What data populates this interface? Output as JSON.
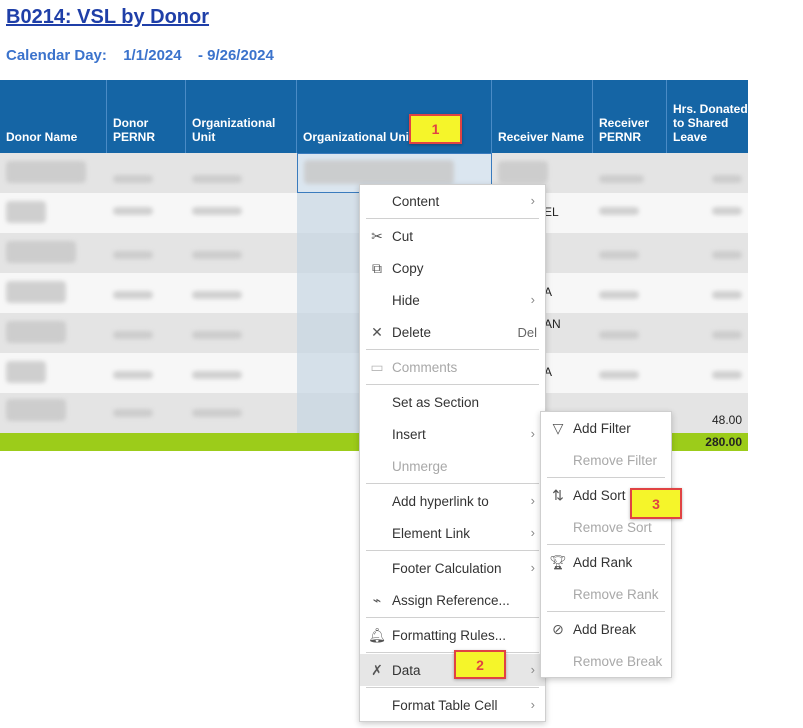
{
  "report": {
    "title": "B0214: VSL by Donor",
    "calendar_label": "Calendar Day:",
    "date_start": "1/1/2024",
    "date_end": "- 9/26/2024"
  },
  "table": {
    "headers": [
      "Donor Name",
      "Donor PERNR",
      "Organizational Unit",
      "Organizational Unit Desc",
      "Receiver Name",
      "Receiver PERNR",
      "Hrs. Donated to Shared Leave"
    ],
    "row7_value": "48.00",
    "footer_total": "280.00",
    "receiver_name_fragments": [
      "EL",
      "A",
      "AN",
      "A"
    ]
  },
  "annotations": {
    "step1": "1",
    "step2": "2",
    "step3": "3"
  },
  "context_menu": {
    "items": [
      {
        "label": "Content",
        "icon": "",
        "submenu": true
      },
      {
        "label": "Cut",
        "icon": "scissors-icon"
      },
      {
        "label": "Copy",
        "icon": "copy-icon"
      },
      {
        "label": "Hide",
        "submenu": true
      },
      {
        "label": "Delete",
        "icon": "close-icon",
        "shortcut": "Del"
      },
      {
        "label": "Comments",
        "icon": "comment-icon",
        "disabled": true
      },
      {
        "label": "Set as Section"
      },
      {
        "label": "Insert",
        "submenu": true
      },
      {
        "label": "Unmerge",
        "disabled": true
      },
      {
        "label": "Add hyperlink to",
        "submenu": true
      },
      {
        "label": "Element Link",
        "submenu": true
      },
      {
        "label": "Footer Calculation",
        "submenu": true
      },
      {
        "label": "Assign Reference...",
        "icon": "link-icon"
      },
      {
        "label": "Formatting Rules...",
        "icon": "bell-icon"
      },
      {
        "label": "Data",
        "icon": "tools-icon",
        "submenu": true,
        "highlighted": true
      },
      {
        "label": "Format Table Cell",
        "submenu": true
      }
    ]
  },
  "data_submenu": {
    "items": [
      {
        "label": "Add Filter",
        "icon": "filter-icon"
      },
      {
        "label": "Remove Filter",
        "disabled": true
      },
      {
        "label": "Add Sort",
        "icon": "sort-icon"
      },
      {
        "label": "Remove Sort",
        "disabled": true
      },
      {
        "label": "Add Rank",
        "icon": "trophy-icon"
      },
      {
        "label": "Remove Rank",
        "disabled": true
      },
      {
        "label": "Add Break",
        "icon": "break-icon"
      },
      {
        "label": "Remove Break",
        "disabled": true
      }
    ]
  },
  "colors": {
    "header_bg": "#1565a5",
    "footer_bg": "#9ccc1a",
    "title": "#1f3fa8",
    "highlight": "#f5f52a",
    "callout_border": "#e04343"
  }
}
